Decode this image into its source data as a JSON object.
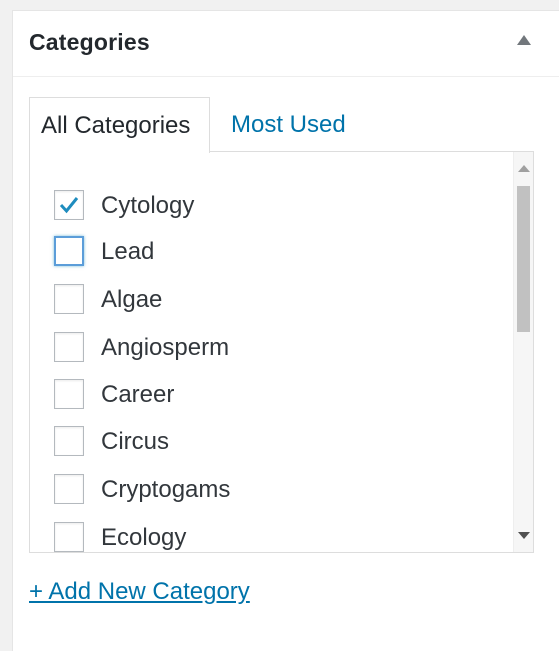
{
  "box": {
    "title": "Categories"
  },
  "tabs": [
    {
      "label": "All Categories",
      "active": true
    },
    {
      "label": "Most Used",
      "active": false
    }
  ],
  "categories": [
    {
      "label": "Cytology",
      "checked": true
    },
    {
      "label": "Lead",
      "checked": false,
      "focused": true
    },
    {
      "label": "Algae",
      "checked": false
    },
    {
      "label": "Angiosperm",
      "checked": false
    },
    {
      "label": "Career",
      "checked": false
    },
    {
      "label": "Circus",
      "checked": false
    },
    {
      "label": "Cryptogams",
      "checked": false
    },
    {
      "label": "Ecology",
      "checked": false
    }
  ],
  "add_new_label": "+ Add New Category",
  "colors": {
    "link": "#0073aa",
    "check": "#1e8cbe",
    "focus": "#5b9dd9"
  }
}
